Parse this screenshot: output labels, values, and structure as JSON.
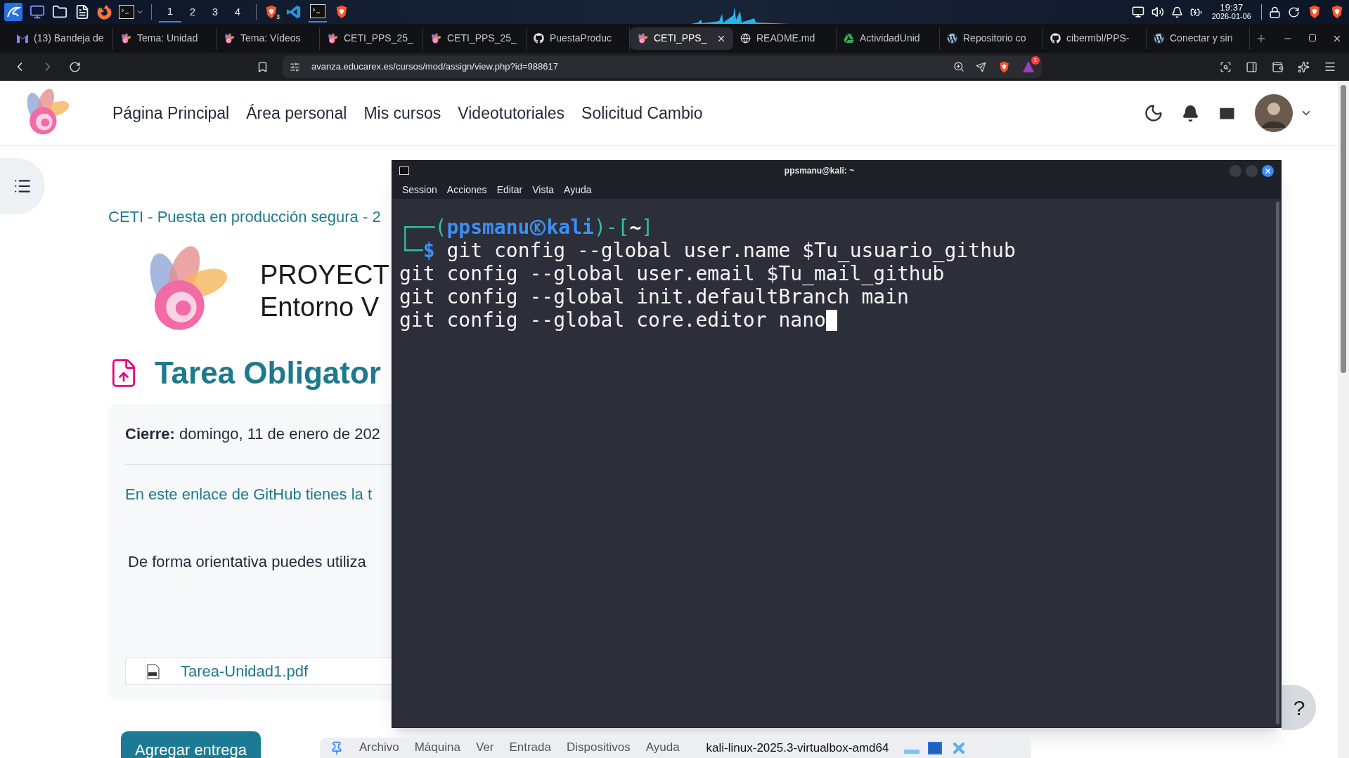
{
  "panel": {
    "workspaces": [
      {
        "label": "1",
        "selected": true
      },
      {
        "label": "2",
        "selected": false
      },
      {
        "label": "3",
        "selected": false
      },
      {
        "label": "4",
        "selected": false
      }
    ],
    "badge": "3",
    "time": "19:37",
    "date": "2026-01-06"
  },
  "browser": {
    "tabs": [
      {
        "label": "(13) Bandeja de",
        "kind": "mail",
        "selected": false
      },
      {
        "label": "Tema: Unidad",
        "kind": "flower",
        "selected": false
      },
      {
        "label": "Tema: Vídeos",
        "kind": "flower",
        "selected": false
      },
      {
        "label": "CETI_PPS_25_",
        "kind": "flower",
        "selected": false
      },
      {
        "label": "CETI_PPS_25_",
        "kind": "flower",
        "selected": false
      },
      {
        "label": "PuestaProduc",
        "kind": "github",
        "selected": false
      },
      {
        "label": "CETI_PPS_",
        "kind": "flower",
        "selected": true
      },
      {
        "label": "README.md",
        "kind": "globe",
        "selected": false
      },
      {
        "label": "ActividadUnid",
        "kind": "drive",
        "selected": false
      },
      {
        "label": "Repositorio co",
        "kind": "wordpress",
        "selected": false
      },
      {
        "label": "cibermbl/PPS-",
        "kind": "github",
        "selected": false
      },
      {
        "label": "Conectar y sin",
        "kind": "wordpress",
        "selected": false
      }
    ],
    "url": "avanza.educarex.es/cursos/mod/assign/view.php?id=988617",
    "badge": "1"
  },
  "site": {
    "nav": [
      "Página Principal",
      "Área personal",
      "Mis cursos",
      "Videotutoriales",
      "Solicitud Cambio"
    ],
    "breadcrumb": [
      "CETI - Puesta en producción segura - 2"
    ],
    "banner": {
      "title": "PROYECT",
      "subtitle": "Entorno V"
    },
    "heading": "Tarea Obligator",
    "card": {
      "due": "**Cierre:** domingo, 11 de enero de 202",
      "link": "En este enlace de GitHub tienes la t",
      "note": "De forma orientativa puedes utiliza",
      "file": {
        "name": "Tarea-Unidad1.pdf"
      }
    },
    "submit_button": "Agregar entrega",
    "help": "?"
  },
  "terminal": {
    "title": "ppsmanu@kali: ~",
    "menu": [
      "Session",
      "Acciones",
      "Editar",
      "Vista",
      "Ayuda"
    ],
    "prompt": {
      "open": "┌──(",
      "user": "ppsmanu",
      "host": "kali",
      "mid": ")-[",
      "dir": "~",
      "close": "]",
      "second": "└─",
      "symbol": "$"
    },
    "lines": [
      "git config --global user.name $Tu_usuario_github",
      "git config --global user.email $Tu_mail_github",
      "git config --global init.defaultBranch main",
      "git config --global core.editor nano"
    ],
    "cursor": true
  },
  "vbox": {
    "menu": [
      "Archivo",
      "Máquina",
      "Ver",
      "Entrada",
      "Dispositivos",
      "Ayuda"
    ],
    "machine": "kali-linux-2025.3-virtualbox-amd64"
  }
}
